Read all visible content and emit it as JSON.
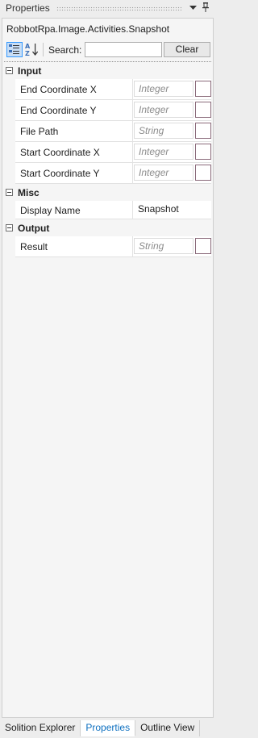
{
  "window": {
    "title": "Properties",
    "dropdown_glyph": "▼",
    "pin_glyph": "📌"
  },
  "object_name": "RobbotRpa.Image.Activities.Snapshot",
  "toolbar": {
    "sort_categorized_icon": "categorized-icon",
    "sort_alpha_icon": "sort-alpha-icon",
    "search_label": "Search:",
    "search_value": "",
    "clear_label": "Clear"
  },
  "categories": {
    "input": {
      "label": "Input",
      "properties": [
        {
          "name": "End Coordinate X",
          "value": "Integer"
        },
        {
          "name": "End Coordinate Y",
          "value": "Integer"
        },
        {
          "name": "File Path",
          "value": "String"
        },
        {
          "name": "Start Coordinate X",
          "value": "Integer"
        },
        {
          "name": "Start Coordinate Y",
          "value": "Integer"
        }
      ]
    },
    "misc": {
      "label": "Misc",
      "properties": [
        {
          "name": "Display Name",
          "value": "Snapshot"
        }
      ]
    },
    "output": {
      "label": "Output",
      "properties": [
        {
          "name": "Result",
          "value": "String"
        }
      ]
    }
  },
  "bottom_tabs": [
    {
      "label": "Solition Explorer"
    },
    {
      "label": "Properties"
    },
    {
      "label": "Outline View"
    }
  ],
  "colors": {
    "accent": "#0e70c0",
    "selection": "#c9def5"
  }
}
